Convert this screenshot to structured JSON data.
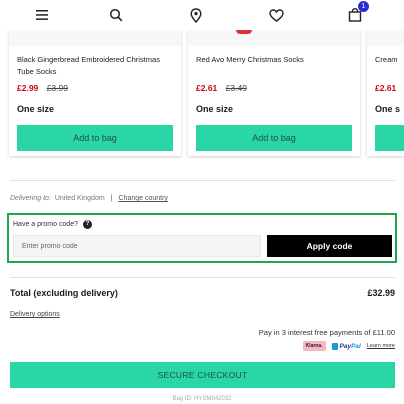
{
  "header": {
    "icons": [
      "menu-icon",
      "search-icon",
      "location-pin-icon",
      "heart-icon",
      "shopping-bag-icon"
    ],
    "bag_count": "1"
  },
  "products": [
    {
      "name": "Black Gingerbread Embroidered Christmas Tube Socks",
      "price_now": "£2.99",
      "price_was": "£3.99",
      "size": "One size",
      "button_label": "Add to bag"
    },
    {
      "name": "Red Avo Merry Christmas Socks",
      "price_now": "£2.61",
      "price_was": "£3.49",
      "size": "One size",
      "button_label": "Add to bag"
    },
    {
      "name": "Cream",
      "price_now": "£2.61",
      "size": "One s",
      "button_label": ""
    }
  ],
  "delivery": {
    "prefix": "Delivering to:",
    "country": "United Kingdom",
    "separator": "|",
    "change_label": "Change country"
  },
  "promo": {
    "label": "Have a promo code?",
    "help_glyph": "?",
    "input_placeholder": "Enter promo code",
    "input_value": "",
    "apply_label": "Apply code"
  },
  "totals": {
    "label": "Total (excluding delivery)",
    "value": "£32.99",
    "delivery_options_label": "Delivery options",
    "installments_text": "Pay in 3 interest free payments of £11.00",
    "klarna_label": "Klarna.",
    "paypal_pay": "Pay",
    "paypal_pal": "Pal",
    "learn_more_label": "Learn more"
  },
  "checkout": {
    "button_label": "SECURE CHECKOUT",
    "bag_id": "Bag ID: HYSM842032"
  },
  "colors": {
    "accent": "#2bd6a6",
    "sale_red": "#d0021b",
    "promo_border": "#1fa84a",
    "badge_blue": "#2b2bd8"
  }
}
